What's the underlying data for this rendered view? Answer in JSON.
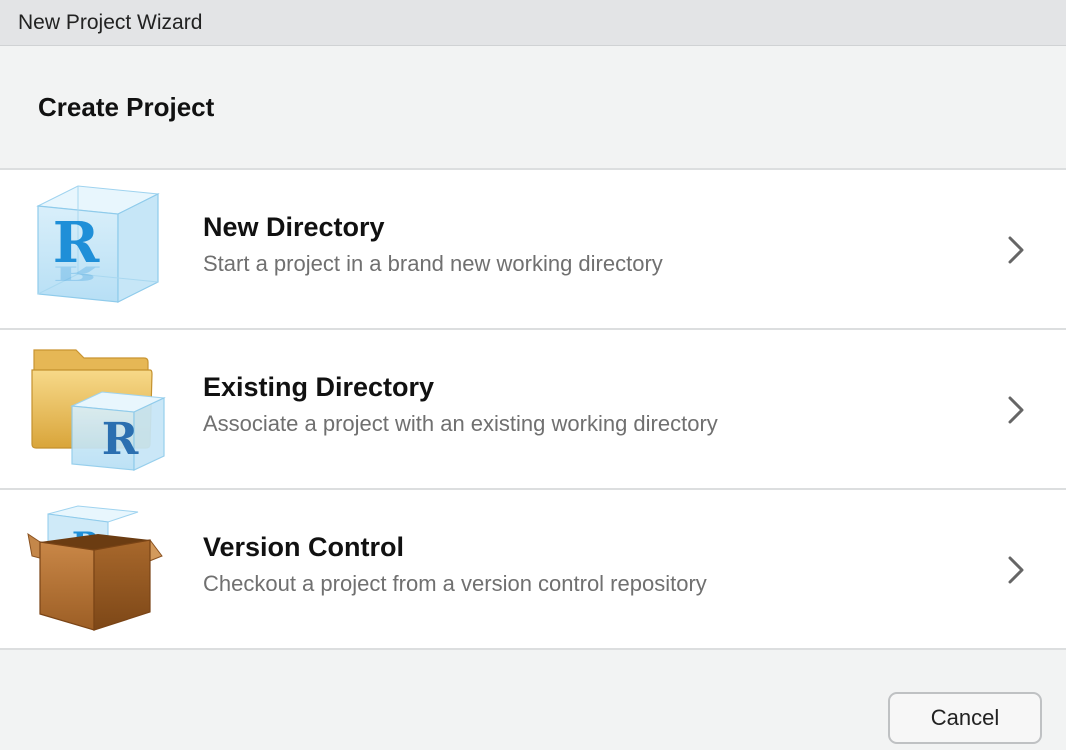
{
  "window": {
    "title": "New Project Wizard"
  },
  "header": {
    "title": "Create Project"
  },
  "options": [
    {
      "label": "New Directory",
      "description": "Start a project in a brand new working directory",
      "icon": "r-cube-icon"
    },
    {
      "label": "Existing Directory",
      "description": "Associate a project with an existing working directory",
      "icon": "folder-r-cube-icon"
    },
    {
      "label": "Version Control",
      "description": "Checkout a project from a version control repository",
      "icon": "box-r-cube-icon"
    }
  ],
  "footer": {
    "cancel_label": "Cancel"
  },
  "colors": {
    "titlebar_bg": "#e3e4e6",
    "panel_bg": "#f2f3f3",
    "option_bg": "#ffffff",
    "description_text": "#707070",
    "r_blue": "#1f8fd8"
  }
}
